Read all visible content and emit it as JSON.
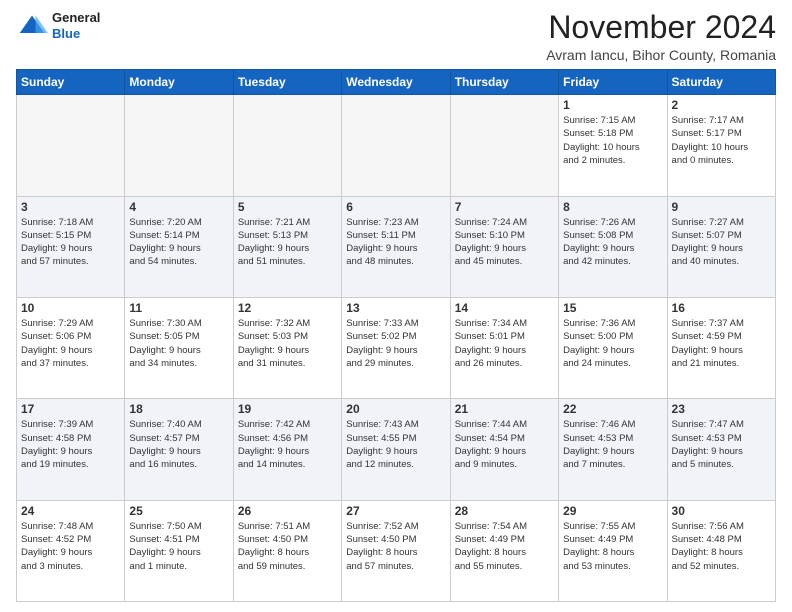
{
  "header": {
    "logo_line1": "General",
    "logo_line2": "Blue",
    "month_title": "November 2024",
    "location": "Avram Iancu, Bihor County, Romania"
  },
  "calendar": {
    "days_of_week": [
      "Sunday",
      "Monday",
      "Tuesday",
      "Wednesday",
      "Thursday",
      "Friday",
      "Saturday"
    ],
    "weeks": [
      [
        {
          "day": "",
          "info": ""
        },
        {
          "day": "",
          "info": ""
        },
        {
          "day": "",
          "info": ""
        },
        {
          "day": "",
          "info": ""
        },
        {
          "day": "",
          "info": ""
        },
        {
          "day": "1",
          "info": "Sunrise: 7:15 AM\nSunset: 5:18 PM\nDaylight: 10 hours\nand 2 minutes."
        },
        {
          "day": "2",
          "info": "Sunrise: 7:17 AM\nSunset: 5:17 PM\nDaylight: 10 hours\nand 0 minutes."
        }
      ],
      [
        {
          "day": "3",
          "info": "Sunrise: 7:18 AM\nSunset: 5:15 PM\nDaylight: 9 hours\nand 57 minutes."
        },
        {
          "day": "4",
          "info": "Sunrise: 7:20 AM\nSunset: 5:14 PM\nDaylight: 9 hours\nand 54 minutes."
        },
        {
          "day": "5",
          "info": "Sunrise: 7:21 AM\nSunset: 5:13 PM\nDaylight: 9 hours\nand 51 minutes."
        },
        {
          "day": "6",
          "info": "Sunrise: 7:23 AM\nSunset: 5:11 PM\nDaylight: 9 hours\nand 48 minutes."
        },
        {
          "day": "7",
          "info": "Sunrise: 7:24 AM\nSunset: 5:10 PM\nDaylight: 9 hours\nand 45 minutes."
        },
        {
          "day": "8",
          "info": "Sunrise: 7:26 AM\nSunset: 5:08 PM\nDaylight: 9 hours\nand 42 minutes."
        },
        {
          "day": "9",
          "info": "Sunrise: 7:27 AM\nSunset: 5:07 PM\nDaylight: 9 hours\nand 40 minutes."
        }
      ],
      [
        {
          "day": "10",
          "info": "Sunrise: 7:29 AM\nSunset: 5:06 PM\nDaylight: 9 hours\nand 37 minutes."
        },
        {
          "day": "11",
          "info": "Sunrise: 7:30 AM\nSunset: 5:05 PM\nDaylight: 9 hours\nand 34 minutes."
        },
        {
          "day": "12",
          "info": "Sunrise: 7:32 AM\nSunset: 5:03 PM\nDaylight: 9 hours\nand 31 minutes."
        },
        {
          "day": "13",
          "info": "Sunrise: 7:33 AM\nSunset: 5:02 PM\nDaylight: 9 hours\nand 29 minutes."
        },
        {
          "day": "14",
          "info": "Sunrise: 7:34 AM\nSunset: 5:01 PM\nDaylight: 9 hours\nand 26 minutes."
        },
        {
          "day": "15",
          "info": "Sunrise: 7:36 AM\nSunset: 5:00 PM\nDaylight: 9 hours\nand 24 minutes."
        },
        {
          "day": "16",
          "info": "Sunrise: 7:37 AM\nSunset: 4:59 PM\nDaylight: 9 hours\nand 21 minutes."
        }
      ],
      [
        {
          "day": "17",
          "info": "Sunrise: 7:39 AM\nSunset: 4:58 PM\nDaylight: 9 hours\nand 19 minutes."
        },
        {
          "day": "18",
          "info": "Sunrise: 7:40 AM\nSunset: 4:57 PM\nDaylight: 9 hours\nand 16 minutes."
        },
        {
          "day": "19",
          "info": "Sunrise: 7:42 AM\nSunset: 4:56 PM\nDaylight: 9 hours\nand 14 minutes."
        },
        {
          "day": "20",
          "info": "Sunrise: 7:43 AM\nSunset: 4:55 PM\nDaylight: 9 hours\nand 12 minutes."
        },
        {
          "day": "21",
          "info": "Sunrise: 7:44 AM\nSunset: 4:54 PM\nDaylight: 9 hours\nand 9 minutes."
        },
        {
          "day": "22",
          "info": "Sunrise: 7:46 AM\nSunset: 4:53 PM\nDaylight: 9 hours\nand 7 minutes."
        },
        {
          "day": "23",
          "info": "Sunrise: 7:47 AM\nSunset: 4:53 PM\nDaylight: 9 hours\nand 5 minutes."
        }
      ],
      [
        {
          "day": "24",
          "info": "Sunrise: 7:48 AM\nSunset: 4:52 PM\nDaylight: 9 hours\nand 3 minutes."
        },
        {
          "day": "25",
          "info": "Sunrise: 7:50 AM\nSunset: 4:51 PM\nDaylight: 9 hours\nand 1 minute."
        },
        {
          "day": "26",
          "info": "Sunrise: 7:51 AM\nSunset: 4:50 PM\nDaylight: 8 hours\nand 59 minutes."
        },
        {
          "day": "27",
          "info": "Sunrise: 7:52 AM\nSunset: 4:50 PM\nDaylight: 8 hours\nand 57 minutes."
        },
        {
          "day": "28",
          "info": "Sunrise: 7:54 AM\nSunset: 4:49 PM\nDaylight: 8 hours\nand 55 minutes."
        },
        {
          "day": "29",
          "info": "Sunrise: 7:55 AM\nSunset: 4:49 PM\nDaylight: 8 hours\nand 53 minutes."
        },
        {
          "day": "30",
          "info": "Sunrise: 7:56 AM\nSunset: 4:48 PM\nDaylight: 8 hours\nand 52 minutes."
        }
      ]
    ]
  }
}
